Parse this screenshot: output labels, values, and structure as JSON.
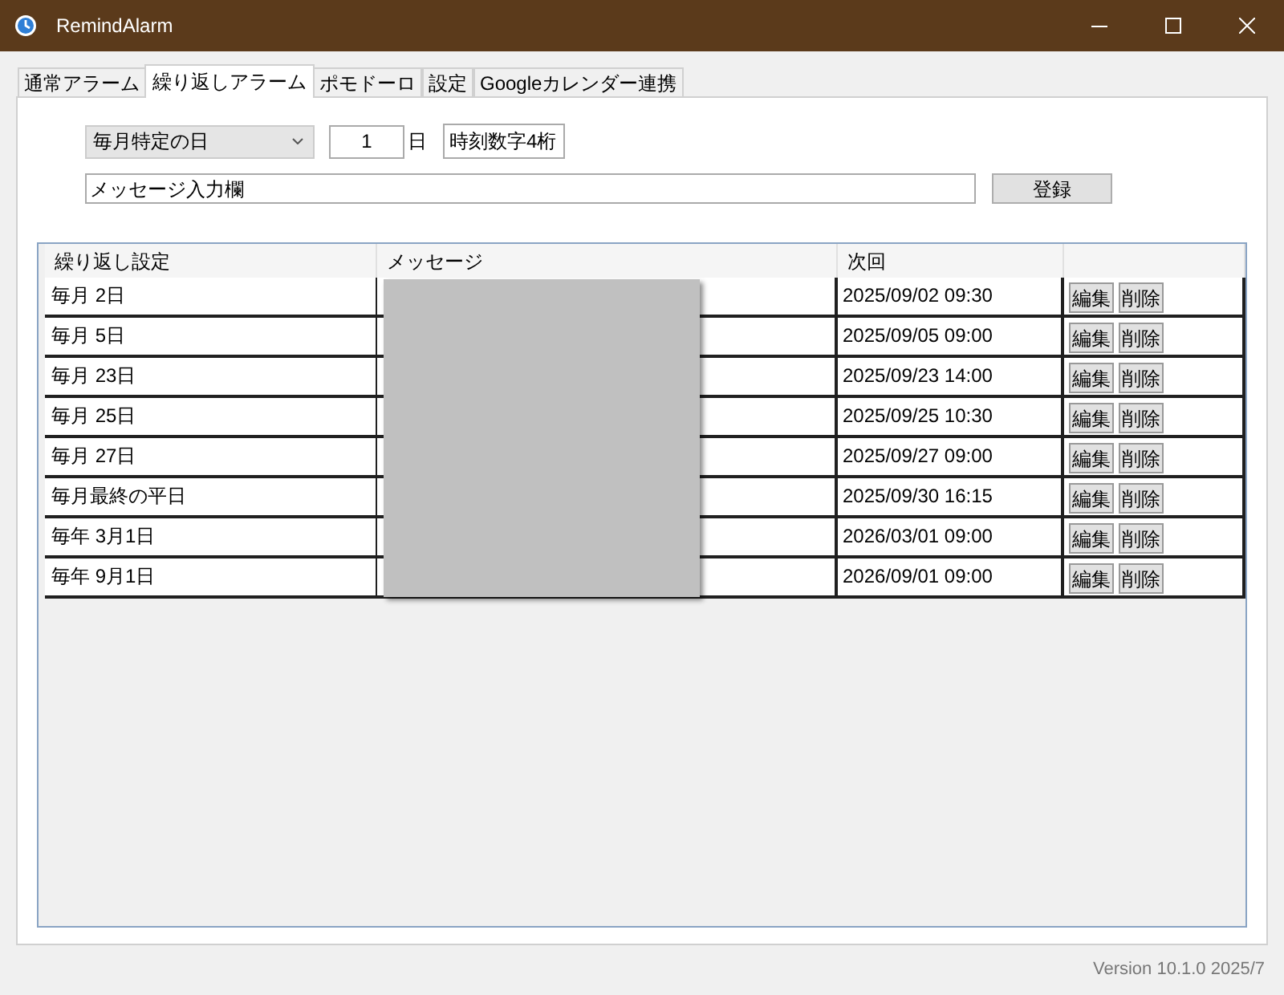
{
  "window": {
    "title": "RemindAlarm"
  },
  "tabs": [
    {
      "label": "通常アラーム",
      "selected": false
    },
    {
      "label": "繰り返しアラーム",
      "selected": true
    },
    {
      "label": "ポモドーロ",
      "selected": false
    },
    {
      "label": "設定",
      "selected": false
    },
    {
      "label": "Googleカレンダー連携",
      "selected": false
    }
  ],
  "form": {
    "repeat_type": "毎月特定の日",
    "day_value": "1",
    "day_unit": "日",
    "time_field": "時刻数字4桁",
    "message_placeholder": "メッセージ入力欄",
    "register_button": "登録"
  },
  "table": {
    "columns": [
      "繰り返し設定",
      "メッセージ",
      "次回"
    ],
    "rows": [
      {
        "repeat": "毎月 2日",
        "next": "2025/09/02 09:30",
        "edit": "編集",
        "delete": "削除"
      },
      {
        "repeat": "毎月 5日",
        "next": "2025/09/05 09:00",
        "edit": "編集",
        "delete": "削除"
      },
      {
        "repeat": "毎月 23日",
        "next": "2025/09/23 14:00",
        "edit": "編集",
        "delete": "削除"
      },
      {
        "repeat": "毎月 25日",
        "next": "2025/09/25 10:30",
        "edit": "編集",
        "delete": "削除"
      },
      {
        "repeat": "毎月 27日",
        "next": "2025/09/27 09:00",
        "edit": "編集",
        "delete": "削除"
      },
      {
        "repeat": "毎月最終の平日",
        "next": "2025/09/30 16:15",
        "edit": "編集",
        "delete": "削除"
      },
      {
        "repeat": "毎年 3月1日",
        "next": "2026/03/01 09:00",
        "edit": "編集",
        "delete": "削除"
      },
      {
        "repeat": "毎年 9月1日",
        "next": "2026/09/01 09:00",
        "edit": "編集",
        "delete": "削除"
      }
    ]
  },
  "status_bar": {
    "version": "Version 10.1.0 2025/7"
  }
}
